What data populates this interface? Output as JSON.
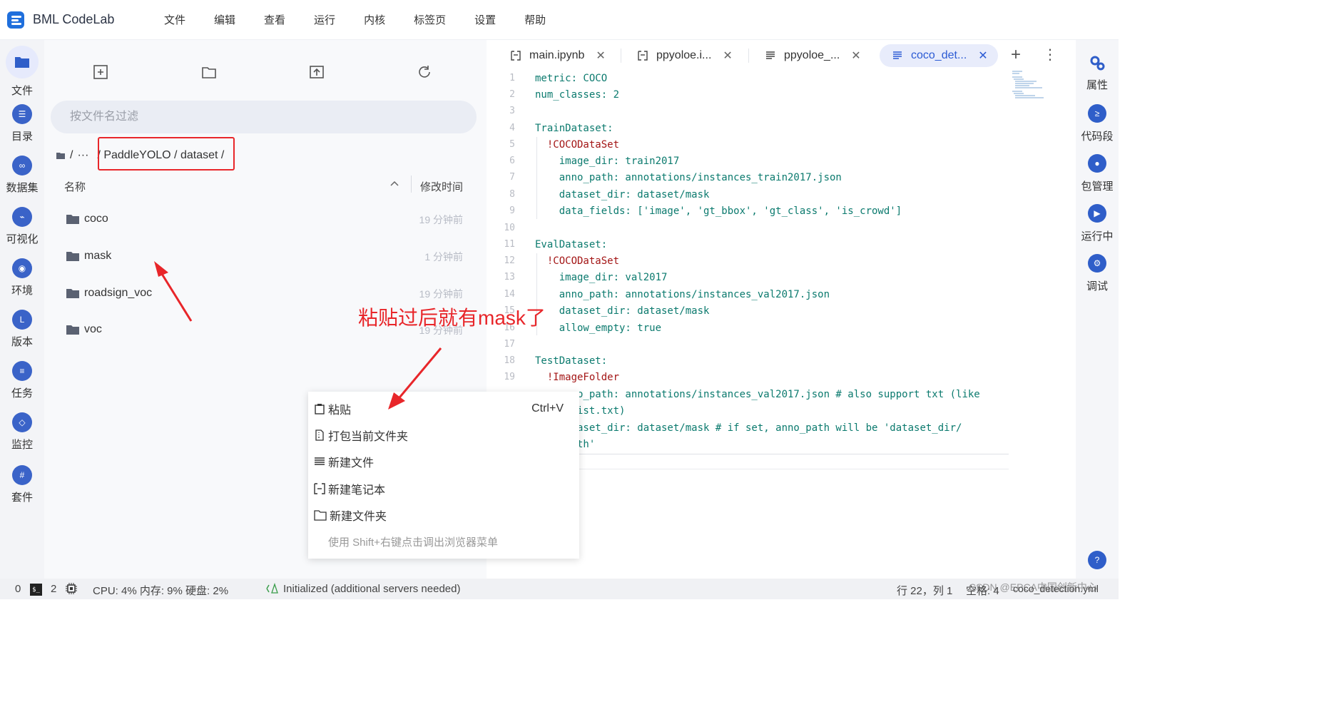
{
  "app": {
    "title": "BML CodeLab",
    "brand_color": "#1f6fdc"
  },
  "menu": [
    "文件",
    "编辑",
    "查看",
    "运行",
    "内核",
    "标签页",
    "设置",
    "帮助"
  ],
  "leftbar": [
    {
      "label": "文件",
      "icon": "folder-icon"
    },
    {
      "label": "目录",
      "icon": "list-icon"
    },
    {
      "label": "数据集",
      "icon": "dataset-icon"
    },
    {
      "label": "可视化",
      "icon": "chart-icon"
    },
    {
      "label": "环境",
      "icon": "environment-icon"
    },
    {
      "label": "版本",
      "icon": "version-icon"
    },
    {
      "label": "任务",
      "icon": "task-icon"
    },
    {
      "label": "监控",
      "icon": "monitor-icon"
    },
    {
      "label": "套件",
      "icon": "suite-icon"
    }
  ],
  "filebrowser": {
    "toolbar": [
      "new-file-icon",
      "new-folder-icon",
      "upload-icon",
      "refresh-icon"
    ],
    "filter_placeholder": "按文件名过滤",
    "breadcrumb": {
      "root": "/",
      "ellipsis": "···",
      "path": "/ PaddleYOLO / dataset /"
    },
    "columns": {
      "name": "名称",
      "modified": "修改时间"
    },
    "rows": [
      {
        "name": "coco",
        "time": "19 分钟前"
      },
      {
        "name": "mask",
        "time": "1 分钟前"
      },
      {
        "name": "roadsign_voc",
        "time": "19 分钟前"
      },
      {
        "name": "voc",
        "time": "19 分钟前"
      }
    ]
  },
  "tabs": [
    {
      "label": "main.ipynb",
      "icon": "notebook-icon"
    },
    {
      "label": "ppyoloe.i...",
      "icon": "notebook-icon"
    },
    {
      "label": "ppyoloe_...",
      "icon": "text-file-icon"
    },
    {
      "label": "coco_det...",
      "icon": "text-file-icon",
      "active": true
    }
  ],
  "tab_close": "✕",
  "tab_add": "+",
  "tab_more": "⋮",
  "editor": {
    "line_numbers": [
      "1",
      "2",
      "3",
      "4",
      "5",
      "6",
      "7",
      "8",
      "9",
      "10",
      "11",
      "12",
      "13",
      "14",
      "15",
      "16",
      "17",
      "18",
      "19"
    ],
    "lines": [
      "metric: COCO",
      "num_classes: 2",
      "",
      "TrainDataset:",
      "  !COCODataSet",
      "    image_dir: train2017",
      "    anno_path: annotations/instances_train2017.json",
      "    dataset_dir: dataset/mask",
      "    data_fields: ['image', 'gt_bbox', 'gt_class', 'is_crowd']",
      "",
      "EvalDataset:",
      "  !COCODataSet",
      "    image_dir: val2017",
      "    anno_path: annotations/instances_val2017.json",
      "    dataset_dir: dataset/mask",
      "    allow_empty: true",
      "",
      "TestDataset:",
      "  !ImageFolder",
      "    anno_path: annotations/instances_val2017.json # also support txt (like",
      "label_list.txt)",
      "    dataset_dir: dataset/mask # if set, anno_path will be 'dataset_dir/",
      "anno_path'"
    ]
  },
  "rightbar": [
    {
      "label": "属性",
      "icon": "gears-icon"
    },
    {
      "label": "代码段",
      "icon": "code-snippet-icon"
    },
    {
      "label": "包管理",
      "icon": "package-icon"
    },
    {
      "label": "运行中",
      "icon": "running-icon"
    },
    {
      "label": "调试",
      "icon": "debug-icon"
    }
  ],
  "context_menu": {
    "items": [
      {
        "label": "粘贴",
        "shortcut": "Ctrl+V",
        "icon": "clipboard-icon"
      },
      {
        "label": "打包当前文件夹",
        "icon": "zip-icon"
      },
      {
        "label": "新建文件",
        "icon": "text-file-icon"
      },
      {
        "label": "新建笔记本",
        "icon": "notebook-icon"
      },
      {
        "label": "新建文件夹",
        "icon": "folder-outline-icon"
      }
    ],
    "hint": "使用 Shift+右键点击调出浏览器菜单"
  },
  "annotation": {
    "text": "粘贴过后就有mask了",
    "color": "#e8262a"
  },
  "statusbar": {
    "zero": "0",
    "term_icon": "$_",
    "two": "2",
    "resources": "CPU:  4% 内存:  9% 硬盘:  2%",
    "lsp": "Initialized (additional servers needed)",
    "cursor": "行 22，列 1",
    "spaces": "空格: 4",
    "filename": "coco_detection.yml",
    "watermark": "CSDN @EPCA中国创新中心"
  }
}
